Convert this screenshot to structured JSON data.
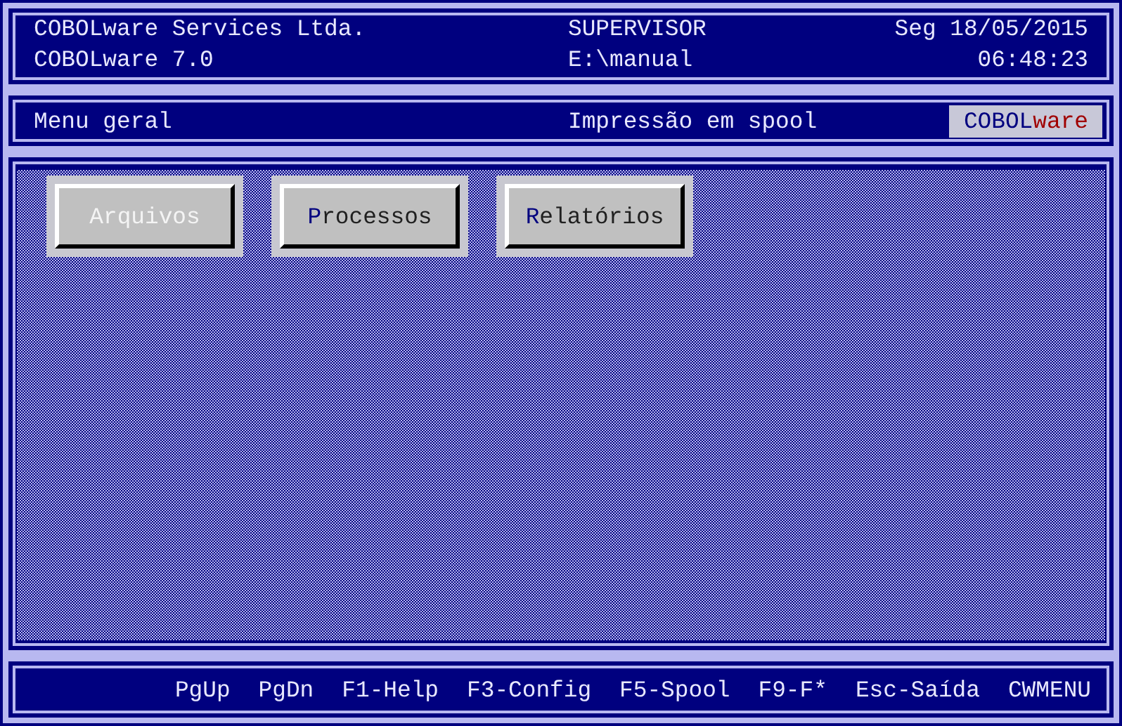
{
  "header": {
    "company": "COBOLware Services Ltda.",
    "product": "COBOLware 7.0",
    "user": "SUPERVISOR",
    "path": "E:\\manual",
    "date": "Seg 18/05/2015",
    "time": "06:48:23"
  },
  "menu_bar": {
    "title": "Menu geral",
    "status": "Impressão em spool",
    "logo": {
      "part_1": "COBOL",
      "part_2": "ware"
    }
  },
  "buttons": [
    {
      "hotkey": "A",
      "rest": "rquivos",
      "selected": true
    },
    {
      "hotkey": "P",
      "rest": "rocessos",
      "selected": false
    },
    {
      "hotkey": "R",
      "rest": "elatórios",
      "selected": false
    }
  ],
  "function_keys": [
    "PgUp",
    "PgDn",
    "F1-Help",
    "F3-Config",
    "F5-Spool",
    "F9-F*",
    "Esc-Saída",
    "CWMENU"
  ]
}
